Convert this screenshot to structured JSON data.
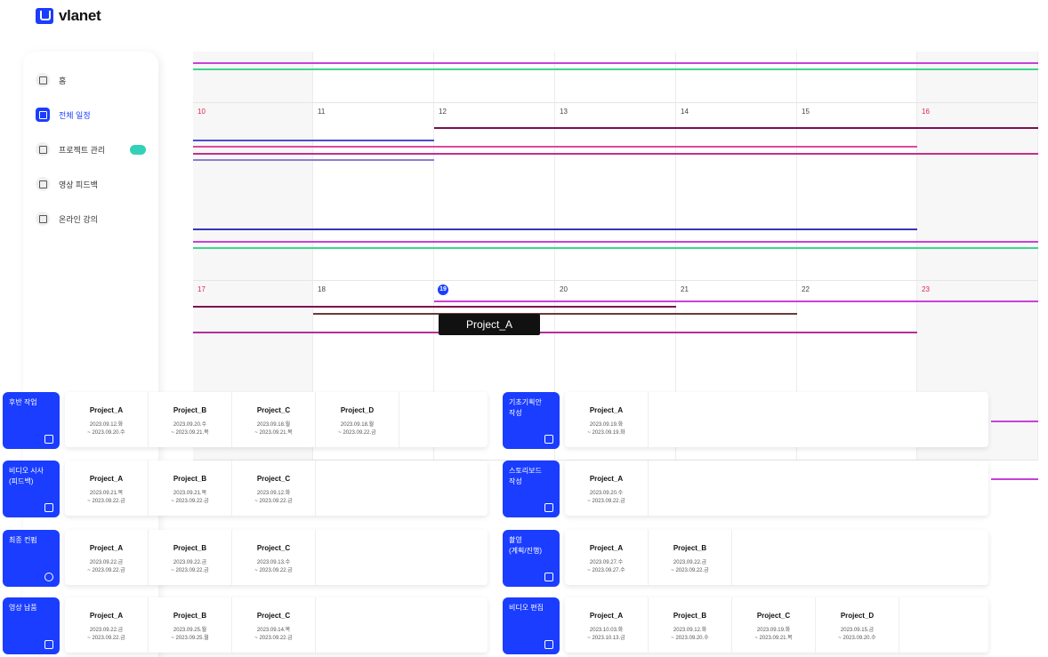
{
  "brand": {
    "name": "vlanet"
  },
  "sidebar": {
    "items": [
      {
        "label": "홈",
        "icon": "home-icon",
        "active": false
      },
      {
        "label": "전체 일정",
        "icon": "calendar-icon",
        "active": true
      },
      {
        "label": "프로젝트 관리",
        "icon": "folder-icon",
        "active": false,
        "badge": ""
      },
      {
        "label": "영상 피드백",
        "icon": "video-feedback-icon",
        "active": false
      },
      {
        "label": "온라인 강의",
        "icon": "graduation-cap-icon",
        "active": false
      }
    ]
  },
  "calendar": {
    "week2": [
      "10",
      "11",
      "12",
      "13",
      "14",
      "15",
      "16"
    ],
    "week3": [
      "17",
      "18",
      "19",
      "20",
      "21",
      "22",
      "23"
    ],
    "today": "19",
    "tooltip": "Project_A",
    "colors": {
      "accent": "#1a3dff",
      "weekend": "#e0244a"
    }
  },
  "stages_left": [
    {
      "label": "후반 작업",
      "icon": "film-icon",
      "projects": [
        {
          "name": "Project_A",
          "start": "2023.09.12.화",
          "end": "~ 2023.09.20.수"
        },
        {
          "name": "Project_B",
          "start": "2023.09.20.수",
          "end": "~ 2023.09.21.목"
        },
        {
          "name": "Project_C",
          "start": "2023.09.18.월",
          "end": "~ 2023.09.21.목"
        },
        {
          "name": "Project_D",
          "start": "2023.09.18.월",
          "end": "~ 2023.09.22.금"
        }
      ]
    },
    {
      "label": "비디오 시사\n(피드백)",
      "icon": "screen-icon",
      "projects": [
        {
          "name": "Project_A",
          "start": "2023.09.21.목",
          "end": "~ 2023.09.22.금"
        },
        {
          "name": "Project_B",
          "start": "2023.09.21.목",
          "end": "~ 2023.09.22.금"
        },
        {
          "name": "Project_C",
          "start": "2023.09.12.화",
          "end": "~ 2023.09.22.금"
        }
      ]
    },
    {
      "label": "최종 컨펌",
      "icon": "check-circle-icon",
      "projects": [
        {
          "name": "Project_A",
          "start": "2023.09.22.금",
          "end": "~ 2023.09.22.금"
        },
        {
          "name": "Project_B",
          "start": "2023.09.22.금",
          "end": "~ 2023.09.22.금"
        },
        {
          "name": "Project_C",
          "start": "2023.09.13.수",
          "end": "~ 2023.09.22.금"
        }
      ]
    },
    {
      "label": "영상 납품",
      "icon": "send-icon",
      "projects": [
        {
          "name": "Project_A",
          "start": "2023.09.22.금",
          "end": "~ 2023.09.22.금"
        },
        {
          "name": "Project_B",
          "start": "2023.09.25.월",
          "end": "~ 2023.09.25.월"
        },
        {
          "name": "Project_C",
          "start": "2023.09.14.목",
          "end": "~ 2023.09.22.금"
        }
      ]
    }
  ],
  "stages_right": [
    {
      "label": "기초기획안\n작성",
      "icon": "edit-icon",
      "projects": [
        {
          "name": "Project_A",
          "start": "2023.09.19.화",
          "end": "~ 2023.09.19.화"
        }
      ]
    },
    {
      "label": "스토리보드\n작성",
      "icon": "edit-icon",
      "projects": [
        {
          "name": "Project_A",
          "start": "2023.09.20.수",
          "end": "~ 2023.09.22.금"
        }
      ]
    },
    {
      "label": "촬영\n(계획/진행)",
      "icon": "camera-icon",
      "projects": [
        {
          "name": "Project_A",
          "start": "2023.09.27.수",
          "end": "~ 2023.09.27.수"
        },
        {
          "name": "Project_B",
          "start": "2023.09.22.금",
          "end": "~ 2023.09.22.금"
        }
      ]
    },
    {
      "label": "비디오 편집",
      "icon": "document-icon",
      "projects": [
        {
          "name": "Project_A",
          "start": "2023.10.03.화",
          "end": "~ 2023.10.13.금"
        },
        {
          "name": "Project_B",
          "start": "2023.09.12.화",
          "end": "~ 2023.09.20.수"
        },
        {
          "name": "Project_C",
          "start": "2023.09.19.화",
          "end": "~ 2023.09.21.목"
        },
        {
          "name": "Project_D",
          "start": "2023.09.15.금",
          "end": "~ 2023.09.20.수"
        }
      ]
    }
  ]
}
